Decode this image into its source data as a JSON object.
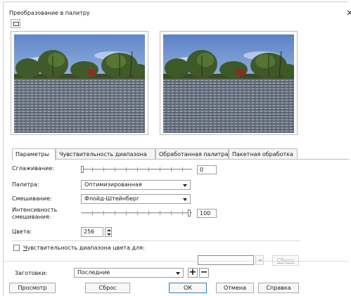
{
  "window": {
    "title": "Преобразование в палитру",
    "close_glyph": "×"
  },
  "tabs": [
    {
      "label": "Параметры",
      "active": true
    },
    {
      "label": "Чувствительность диапазона",
      "active": false
    },
    {
      "label": "Обработанная палитра",
      "active": false
    },
    {
      "label": "Пакетная обработка",
      "active": false
    }
  ],
  "params": {
    "smoothing": {
      "label": "Сглаживание:",
      "value": "0"
    },
    "palette": {
      "label": "Палитра:",
      "value": "Оптимизированная"
    },
    "dithering": {
      "label": "Смешивание:",
      "value": "Флойд-Штейнберг"
    },
    "dither_intensity": {
      "label_line1": "Интенсивность",
      "label_line2": "смешивания:",
      "value": "100"
    },
    "colors": {
      "label": "Цвета:",
      "value": "256"
    }
  },
  "range_sensitivity": {
    "label_first": "Ч",
    "label_rest": "увствительность диапазона цвета для:",
    "checked": false,
    "reset_label": "Сброс"
  },
  "presets": {
    "label": "Заготовки:",
    "value": "Последние",
    "add_glyph": "+",
    "remove_glyph": "−"
  },
  "footer": {
    "preview": "Просмотр",
    "reset": "Сброс",
    "ok": "ОК",
    "cancel": "Отмена",
    "help": "Справка"
  },
  "icons": [
    "view-toggle-icon",
    "close-icon",
    "chevron-down-icon",
    "spin-up-icon",
    "spin-down-icon",
    "plus-icon",
    "minus-icon"
  ],
  "colors": {
    "accent": "#3c7fb1",
    "border": "#bdbdbd",
    "disabled_text": "#b5b5b5"
  }
}
